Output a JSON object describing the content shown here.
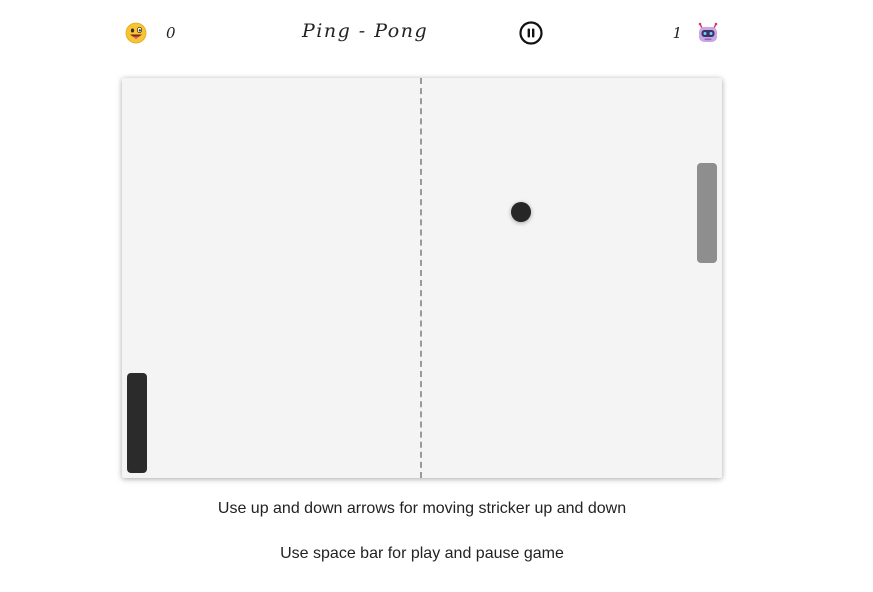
{
  "header": {
    "player_score": "0",
    "title": "Ping - Pong",
    "bot_score": "1",
    "player_avatar_icon": "grinning-tongue-face-icon",
    "pause_icon": "pause-circle-icon",
    "bot_avatar_icon": "robot-face-icon"
  },
  "instructions": {
    "line1": "Use up and down arrows for moving stricker up and down",
    "line2": "Use space bar for play and pause game"
  },
  "colors": {
    "board": "#f4f4f4",
    "player_paddle": "#2b2b2b",
    "bot_paddle": "#8e8e8e",
    "ball": "#262626",
    "center_line": "#9a9a9a"
  }
}
